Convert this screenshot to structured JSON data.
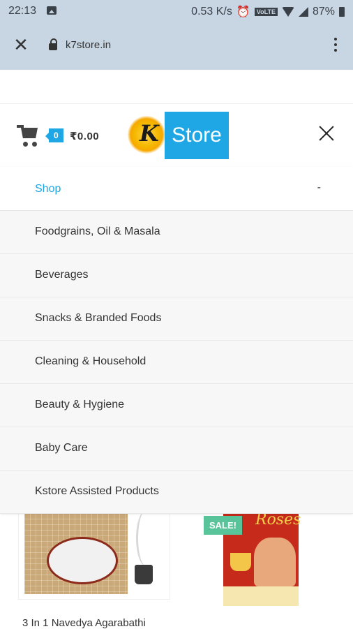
{
  "status_bar": {
    "time": "22:13",
    "network_speed": "0.53 K/s",
    "volte": "VoLTE",
    "battery": "87%"
  },
  "browser": {
    "url": "k7store.in"
  },
  "header": {
    "cart_count": "0",
    "cart_total": "₹0.00",
    "logo_mark": "K",
    "logo_text": "Store"
  },
  "menu": {
    "shop_label": "Shop",
    "shop_toggle": "-",
    "items": [
      "Foodgrains, Oil & Masala",
      "Beverages",
      "Snacks & Branded Foods",
      "Cleaning & Household",
      "Beauty & Hygiene",
      "Baby Care",
      "Kstore Assisted Products"
    ]
  },
  "products": {
    "sale_badge": "SALE!",
    "product2_brand": "Roses",
    "product1_title": "3 In 1  Navedya Agarabathi"
  },
  "colors": {
    "accent": "#1ea7e4",
    "sale": "#59c49a",
    "browser_bar": "#c8d5e3"
  }
}
